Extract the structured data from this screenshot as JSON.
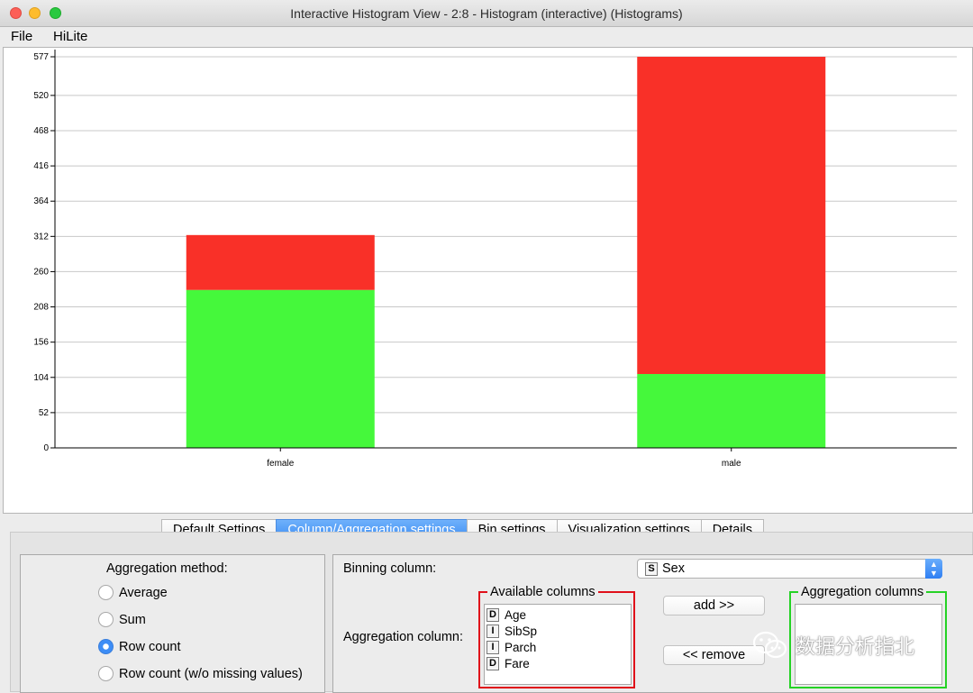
{
  "window": {
    "title": "Interactive Histogram View - 2:8 - Histogram (interactive) (Histograms)"
  },
  "menu": {
    "file": "File",
    "hilite": "HiLite"
  },
  "chart_data": {
    "type": "bar",
    "stacked": true,
    "categories": [
      "female",
      "male"
    ],
    "series": [
      {
        "color": "#45f83b",
        "values": [
          233,
          109
        ]
      },
      {
        "color": "#f93028",
        "values": [
          81,
          468
        ]
      }
    ],
    "totals": [
      314,
      577
    ],
    "yticks": [
      0,
      52,
      104,
      156,
      208,
      260,
      312,
      364,
      416,
      468,
      520,
      577
    ],
    "ylim": [
      0,
      577
    ],
    "grid": true
  },
  "tabs": [
    {
      "label": "Default Settings",
      "active": false
    },
    {
      "label": "Column/Aggregation settings",
      "active": true
    },
    {
      "label": "Bin settings",
      "active": false
    },
    {
      "label": "Visualization settings",
      "active": false
    },
    {
      "label": "Details",
      "active": false
    }
  ],
  "aggregation": {
    "title": "Aggregation method:",
    "options": [
      {
        "label": "Average",
        "checked": false
      },
      {
        "label": "Sum",
        "checked": false
      },
      {
        "label": "Row count",
        "checked": true
      },
      {
        "label": "Row count (w/o missing values)",
        "checked": false
      }
    ]
  },
  "binning": {
    "label": "Binning column:",
    "selected_type": "S",
    "selected": "Sex"
  },
  "aggregation_column": {
    "label": "Aggregation column:",
    "available_title": "Available columns",
    "available": [
      {
        "type": "D",
        "name": "Age"
      },
      {
        "type": "I",
        "name": "SibSp"
      },
      {
        "type": "I",
        "name": "Parch"
      },
      {
        "type": "D",
        "name": "Fare"
      }
    ],
    "selected_title": "Aggregation columns",
    "add_label": "add >>",
    "remove_label": "<< remove"
  },
  "watermark": {
    "text": "数据分析指北",
    "icon": "wechat-icon"
  }
}
